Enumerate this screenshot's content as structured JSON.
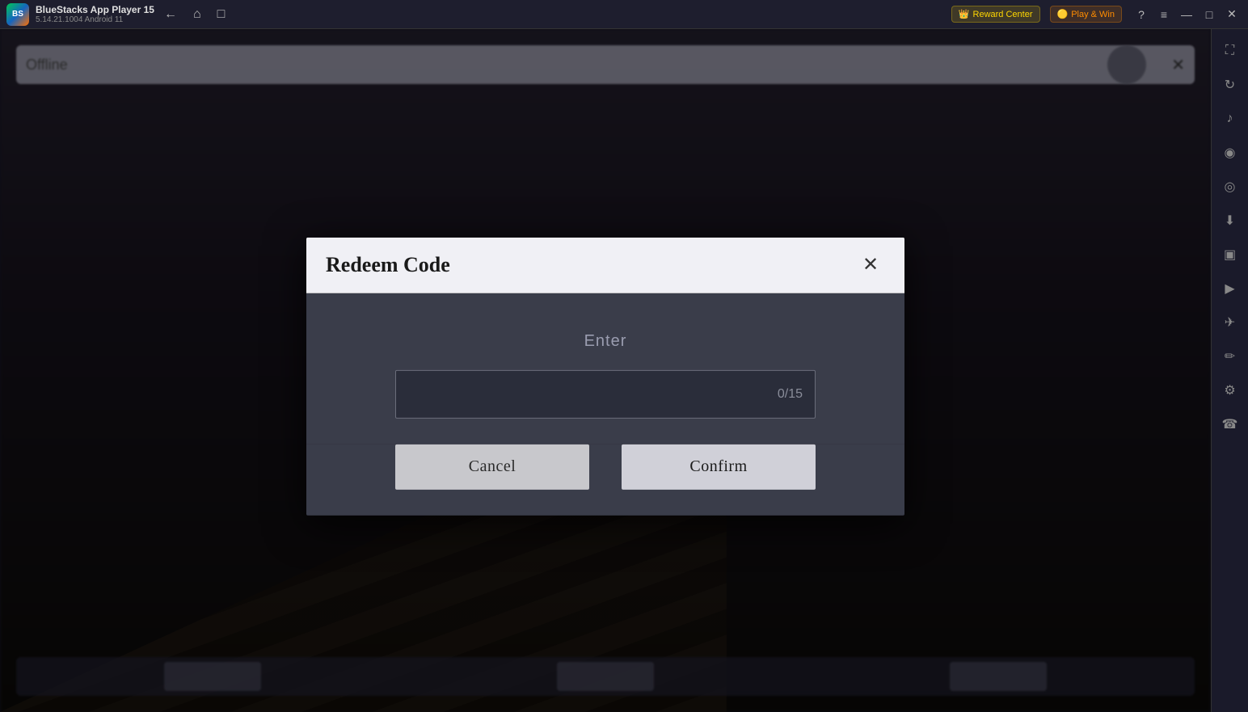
{
  "titlebar": {
    "app_name": "BlueStacks App Player 15",
    "version": "5.14.21.1004  Android 11",
    "reward_center_label": "Reward Center",
    "play_win_label": "Play & Win",
    "help_icon": "?",
    "menu_icon": "≡",
    "minimize_icon": "—",
    "maximize_icon": "□",
    "close_icon": "✕",
    "fullscreen_icon": "⛶"
  },
  "sidebar": {
    "icons": [
      {
        "name": "fullscreen-icon",
        "glyph": "⛶"
      },
      {
        "name": "rotate-icon",
        "glyph": "↻"
      },
      {
        "name": "volume-icon",
        "glyph": "🔊"
      },
      {
        "name": "camera-icon",
        "glyph": "📷"
      },
      {
        "name": "earth-icon",
        "glyph": "🌐"
      },
      {
        "name": "apk-icon",
        "glyph": "📦"
      },
      {
        "name": "screenshot-icon",
        "glyph": "📸"
      },
      {
        "name": "video-icon",
        "glyph": "🎬"
      },
      {
        "name": "plane-icon",
        "glyph": "✈"
      },
      {
        "name": "brush-icon",
        "glyph": "🖌"
      },
      {
        "name": "settings-icon",
        "glyph": "⚙"
      },
      {
        "name": "phone-icon",
        "glyph": "📱"
      }
    ]
  },
  "app_bar": {
    "text": "Offline"
  },
  "modal": {
    "title": "Redeem Code",
    "close_icon": "✕",
    "enter_label": "Enter",
    "char_count": "0/15",
    "input_placeholder": "",
    "cancel_label": "Cancel",
    "confirm_label": "Confirm"
  }
}
